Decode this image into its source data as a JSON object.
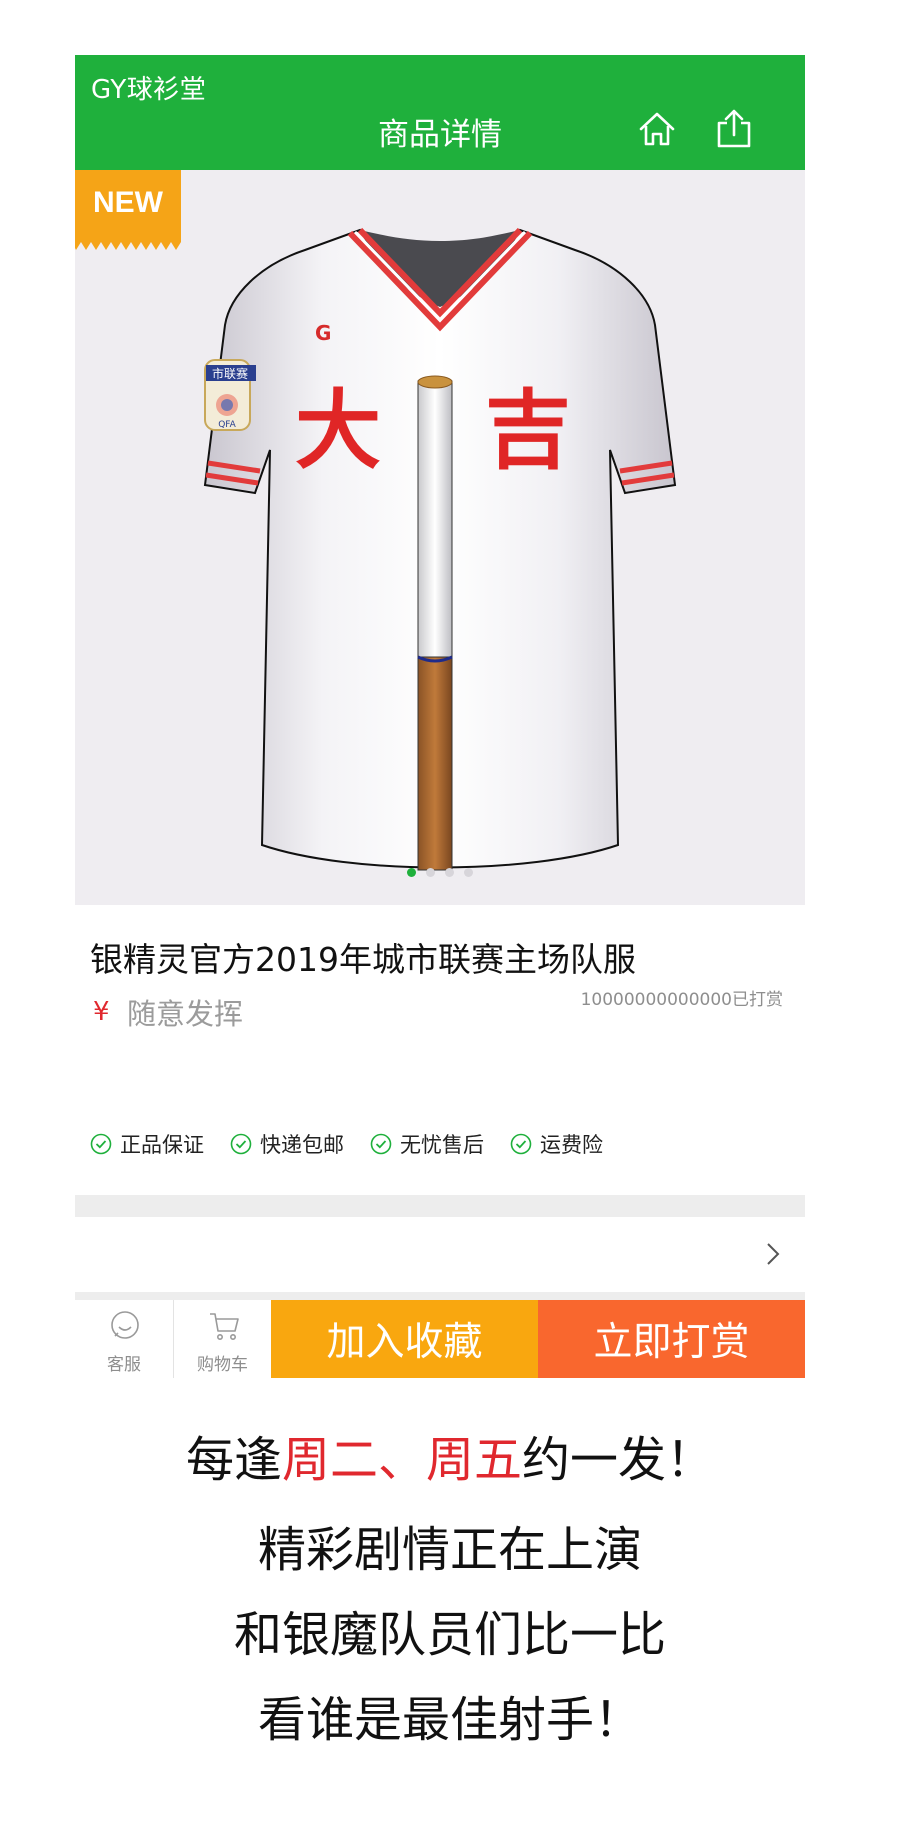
{
  "header": {
    "store_name": "GY球衫堂",
    "title": "商品详情",
    "home_icon": "home-icon",
    "share_icon": "share-icon",
    "color": "#1fb03c"
  },
  "image": {
    "badge": "NEW",
    "badge_color": "#f5a417",
    "jersey": {
      "logo_letter": "G",
      "char_left": "大",
      "char_right": "吉",
      "patch_text": "市联赛",
      "patch_sub": "QFA"
    },
    "carousel_total": 4,
    "carousel_active": 1
  },
  "product": {
    "title": "银精灵官方2019年城市联赛主场队服",
    "currency": "¥",
    "price_text": "随意发挥",
    "tip_count": "10000000000000已打赏"
  },
  "guarantees": [
    "正品保证",
    "快递包邮",
    "无忧售后",
    "运费险"
  ],
  "action_bar": {
    "service_label": "客服",
    "cart_label": "购物车",
    "favorite_label": "加入收藏",
    "tip_label": "立即打赏",
    "favorite_color": "#f9a70f",
    "tip_color": "#f9672e"
  },
  "caption": {
    "line1_pre": "每逢",
    "line1_highlight": "周二、周五",
    "line1_post": "约一发！",
    "line2": "精彩剧情正在上演",
    "line3": "和银魔队员们比一比",
    "line4": "看谁是最佳射手！"
  }
}
